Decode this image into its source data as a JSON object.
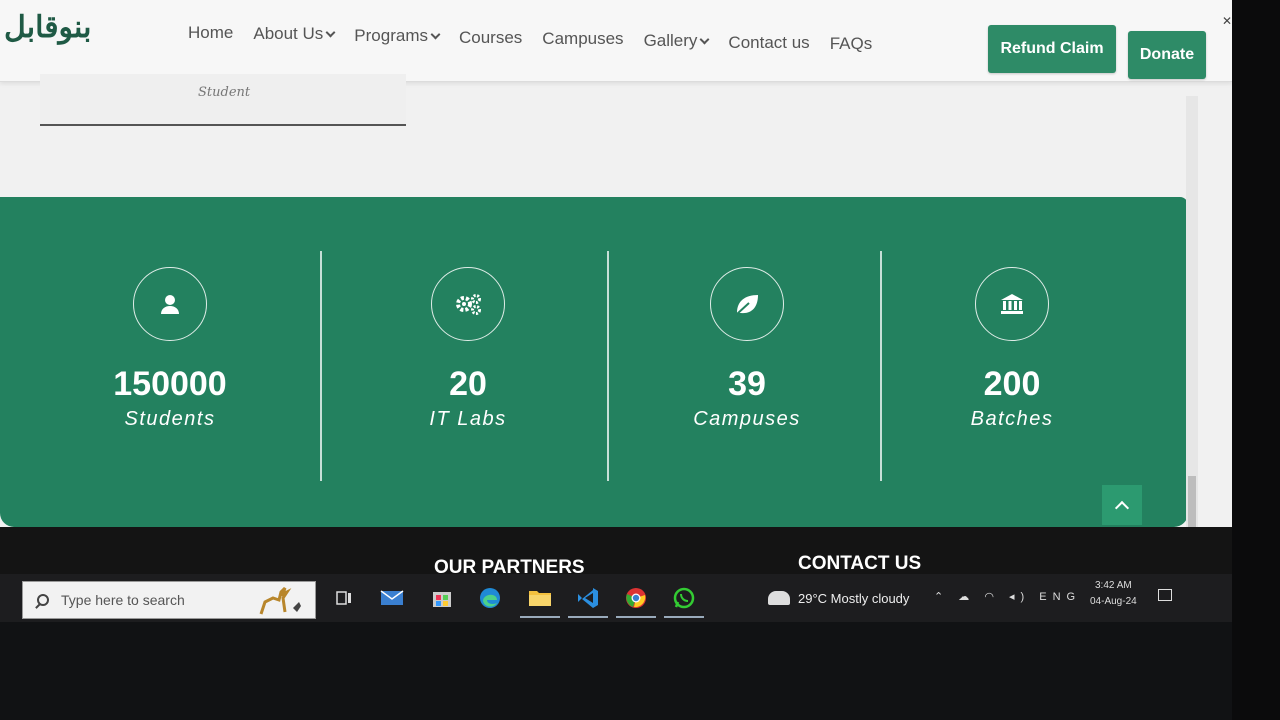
{
  "header": {
    "logo_text": "بنوقابل",
    "nav": [
      {
        "label": "Home",
        "dropdown": false
      },
      {
        "label": "About Us",
        "dropdown": true
      },
      {
        "label": "Programs",
        "dropdown": true
      },
      {
        "label": "Courses",
        "dropdown": false
      },
      {
        "label": "Campuses",
        "dropdown": false
      },
      {
        "label": "Gallery",
        "dropdown": true
      },
      {
        "label": "Contact us",
        "dropdown": false
      },
      {
        "label": "FAQs",
        "dropdown": false
      }
    ],
    "refund_label": "Refund Claim",
    "donate_label": "Donate"
  },
  "student_card": {
    "caption": "Student"
  },
  "stats": [
    {
      "icon": "user-icon",
      "value": "150000",
      "label": "Students"
    },
    {
      "icon": "gears-icon",
      "value": "20",
      "label": "IT Labs"
    },
    {
      "icon": "leaf-icon",
      "value": "39",
      "label": "Campuses"
    },
    {
      "icon": "bank-icon",
      "value": "200",
      "label": "Batches"
    }
  ],
  "footer": {
    "partners_title": "OUR PARTNERS",
    "contact_title": "CONTACT US"
  },
  "taskbar": {
    "search_placeholder": "Type here to search",
    "weather": "29°C  Mostly cloudy",
    "language": "ENG",
    "time": "3:42 AM",
    "date": "04-Aug-24"
  },
  "colors": {
    "brand_green": "#23815f",
    "button_green": "#2e8b67"
  }
}
